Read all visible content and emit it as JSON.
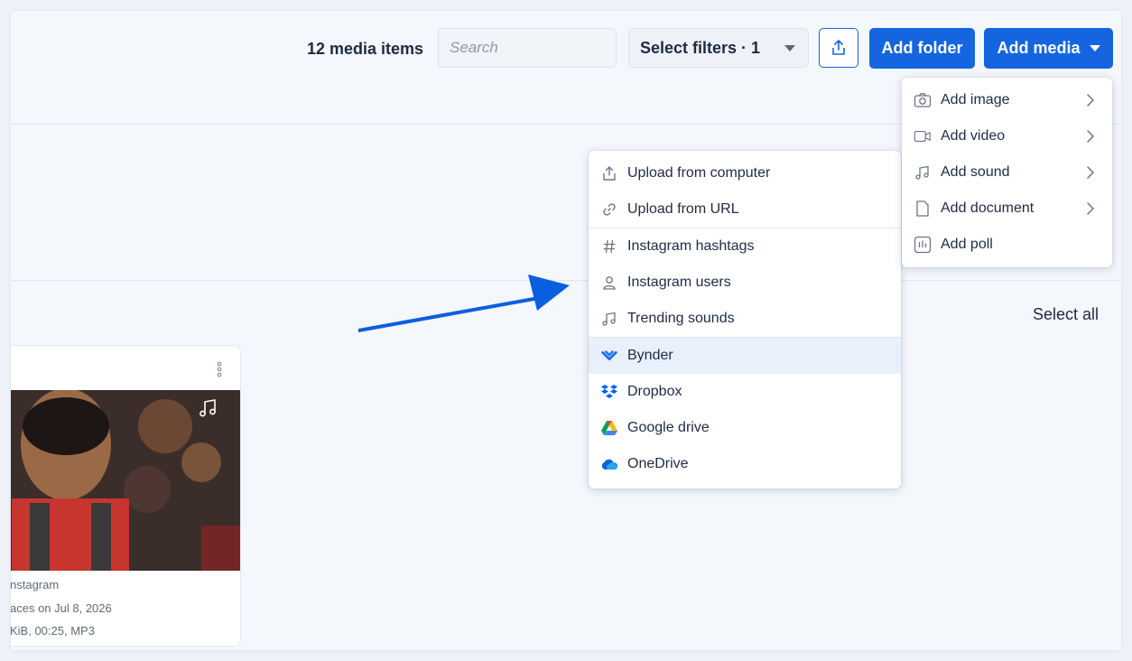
{
  "toolbar": {
    "count_label": "12 media items",
    "search_placeholder": "Search",
    "filters_label": "Select filters · 1",
    "add_folder_label": "Add folder",
    "add_media_label": "Add media"
  },
  "select_all_label": "Select all",
  "card": {
    "meta_source": "nstagram",
    "meta_date": "aces on Jul 8, 2026",
    "meta_info": "KiB, 00:25, MP3"
  },
  "add_media_menu": {
    "items": [
      {
        "label": "Add image",
        "icon": "camera-icon",
        "has_submenu": true
      },
      {
        "label": "Add video",
        "icon": "video-icon",
        "has_submenu": true
      },
      {
        "label": "Add sound",
        "icon": "music-note-icon",
        "has_submenu": true
      },
      {
        "label": "Add document",
        "icon": "document-icon",
        "has_submenu": true
      },
      {
        "label": "Add poll",
        "icon": "poll-icon",
        "has_submenu": false
      }
    ]
  },
  "sources_menu": {
    "items": [
      {
        "label": "Upload from computer",
        "icon": "upload-icon"
      },
      {
        "label": "Upload from URL",
        "icon": "link-icon"
      },
      {
        "label": "Instagram hashtags",
        "icon": "hashtag-icon"
      },
      {
        "label": "Instagram users",
        "icon": "user-icon"
      },
      {
        "label": "Trending sounds",
        "icon": "music-note-icon"
      },
      {
        "label": "Bynder",
        "icon": "bynder-logo-icon"
      },
      {
        "label": "Dropbox",
        "icon": "dropbox-logo-icon"
      },
      {
        "label": "Google drive",
        "icon": "google-drive-logo-icon"
      },
      {
        "label": "OneDrive",
        "icon": "onedrive-logo-icon"
      }
    ],
    "highlighted": "Bynder"
  },
  "colors": {
    "primary": "#1565e0",
    "annotation_arrow": "#0a5fe0",
    "highlight_row": "#e8f0fc"
  }
}
